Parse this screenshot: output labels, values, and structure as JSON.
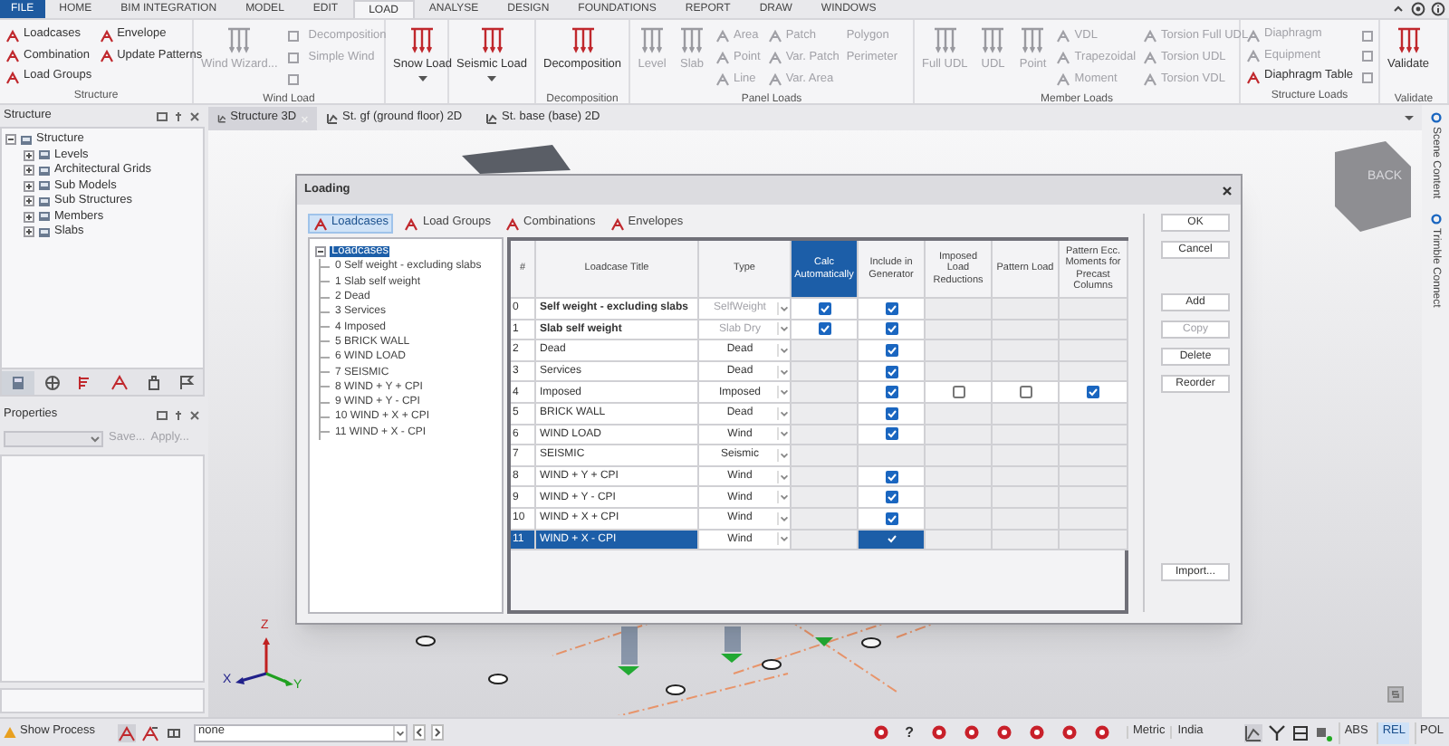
{
  "menu_tabs": [
    {
      "label": "FILE",
      "kind": "file",
      "selected": false
    },
    {
      "label": "HOME",
      "kind": "tab",
      "selected": false
    },
    {
      "label": "BIM INTEGRATION",
      "kind": "tab",
      "selected": false
    },
    {
      "label": "MODEL",
      "kind": "tab",
      "selected": false
    },
    {
      "label": "EDIT",
      "kind": "tab",
      "selected": false
    },
    {
      "label": "LOAD",
      "kind": "tab",
      "selected": true
    },
    {
      "label": "ANALYSE",
      "kind": "tab",
      "selected": false
    },
    {
      "label": "DESIGN",
      "kind": "tab",
      "selected": false
    },
    {
      "label": "FOUNDATIONS",
      "kind": "tab",
      "selected": false
    },
    {
      "label": "REPORT",
      "kind": "tab",
      "selected": false
    },
    {
      "label": "DRAW",
      "kind": "tab",
      "selected": false
    },
    {
      "label": "WINDOWS",
      "kind": "tab",
      "selected": false
    }
  ],
  "ribbon_groups": [
    {
      "label": "Structure",
      "items": [
        {
          "kind": "small",
          "label": "Loadcases",
          "disabled": false
        },
        {
          "kind": "small",
          "label": "Combination",
          "disabled": false
        },
        {
          "kind": "small",
          "label": "Load Groups",
          "disabled": false
        },
        {
          "kind": "small",
          "label": "Envelope",
          "disabled": false
        },
        {
          "kind": "small",
          "label": "Update Patterns",
          "disabled": false
        }
      ]
    },
    {
      "label": "Wind Load",
      "items": [
        {
          "kind": "large",
          "label": "Wind Wizard...",
          "disabled": true
        },
        {
          "kind": "icon",
          "disabled": true
        },
        {
          "kind": "icon",
          "disabled": true
        },
        {
          "kind": "icon",
          "disabled": true
        },
        {
          "kind": "text",
          "label": "Decomposition",
          "disabled": true
        },
        {
          "kind": "text",
          "label": "Simple Wind",
          "disabled": true
        }
      ]
    },
    {
      "items": [
        {
          "kind": "large",
          "label": "Snow Load",
          "dropdown": true,
          "disabled": false
        }
      ]
    },
    {
      "items": [
        {
          "kind": "large",
          "label": "Seismic Load",
          "dropdown": true,
          "disabled": false
        }
      ]
    },
    {
      "label": "Decomposition",
      "items": [
        {
          "kind": "large",
          "label": "Decomposition",
          "disabled": false
        }
      ]
    },
    {
      "label": "Panel Loads",
      "items": [
        {
          "kind": "large",
          "label": "Level",
          "disabled": true
        },
        {
          "kind": "large",
          "label": "Slab",
          "disabled": true
        },
        {
          "kind": "small",
          "label": "Area",
          "disabled": true
        },
        {
          "kind": "small",
          "label": "Point",
          "disabled": true
        },
        {
          "kind": "small",
          "label": "Line",
          "disabled": true
        },
        {
          "kind": "small",
          "label": "Patch",
          "disabled": true
        },
        {
          "kind": "small",
          "label": "Var. Patch",
          "disabled": true
        },
        {
          "kind": "small",
          "label": "Var. Area",
          "disabled": true
        },
        {
          "kind": "text",
          "label": "Polygon",
          "disabled": true
        },
        {
          "kind": "text",
          "label": "Perimeter",
          "disabled": true
        }
      ]
    },
    {
      "label": "Member Loads",
      "items": [
        {
          "kind": "large",
          "label": "Full UDL",
          "disabled": true
        },
        {
          "kind": "large",
          "label": "UDL",
          "disabled": true
        },
        {
          "kind": "large",
          "label": "Point",
          "disabled": true
        },
        {
          "kind": "small",
          "label": "VDL",
          "disabled": true
        },
        {
          "kind": "small",
          "label": "Trapezoidal",
          "disabled": true
        },
        {
          "kind": "small",
          "label": "Moment",
          "disabled": true
        },
        {
          "kind": "small",
          "label": "Torsion Full UDL",
          "disabled": true
        },
        {
          "kind": "small",
          "label": "Torsion UDL",
          "disabled": true
        },
        {
          "kind": "small",
          "label": "Torsion VDL",
          "disabled": true
        }
      ]
    },
    {
      "label": "Structure Loads",
      "items": [
        {
          "kind": "small",
          "label": "Diaphragm",
          "disabled": true
        },
        {
          "kind": "small",
          "label": "Equipment",
          "disabled": true
        },
        {
          "kind": "small",
          "label": "Diaphragm Table",
          "disabled": false
        },
        {
          "kind": "icon",
          "disabled": true
        },
        {
          "kind": "icon",
          "disabled": true
        },
        {
          "kind": "icon",
          "disabled": true
        }
      ]
    },
    {
      "label": "Validate",
      "items": [
        {
          "kind": "large",
          "label": "Validate",
          "disabled": false
        }
      ]
    }
  ],
  "structure_panel": {
    "title": "Structure",
    "tree": [
      {
        "label": "Structure",
        "expanded": true,
        "children": [
          {
            "label": "Levels",
            "expanded": false
          },
          {
            "label": "Architectural Grids",
            "expanded": false
          },
          {
            "label": "Sub Models",
            "expanded": false
          },
          {
            "label": "Sub Structures",
            "expanded": false
          },
          {
            "label": "Members",
            "expanded": false
          },
          {
            "label": "Slabs",
            "expanded": false
          }
        ]
      }
    ],
    "tool_tabs": [
      {
        "selected": true
      },
      {
        "selected": false
      },
      {
        "selected": false
      },
      {
        "selected": false
      },
      {
        "selected": false
      },
      {
        "selected": false
      }
    ]
  },
  "properties_panel": {
    "title": "Properties",
    "buttons": [
      {
        "label": "Save...",
        "disabled": true
      },
      {
        "label": "Apply...",
        "disabled": true
      }
    ]
  },
  "document_tabs": [
    {
      "label": "Structure 3D",
      "selected": true
    },
    {
      "label": "St. gf (ground floor) 2D",
      "selected": false
    },
    {
      "label": "St. base (base) 2D",
      "selected": false
    }
  ],
  "viewport": {
    "axis_labels": [
      "Z",
      "X",
      "Y"
    ],
    "view_cube_label": "BACK"
  },
  "side_tabs": [
    "Scene Content",
    "Trimble Connect"
  ],
  "dialog": {
    "title": "Loading",
    "tabs": [
      {
        "label": "Loadcases",
        "selected": true
      },
      {
        "label": "Load Groups",
        "selected": false
      },
      {
        "label": "Combinations",
        "selected": false
      },
      {
        "label": "Envelopes",
        "selected": false
      }
    ],
    "tree": {
      "label": "Loadcases",
      "selected": true,
      "expanded": true,
      "children": [
        {
          "label": "0 Self weight - excluding slabs",
          "selected": false
        },
        {
          "label": "1 Slab self weight",
          "selected": false
        },
        {
          "label": "2 Dead",
          "selected": false
        },
        {
          "label": "3 Services",
          "selected": false
        },
        {
          "label": "4 Imposed",
          "selected": false
        },
        {
          "label": "5 BRICK WALL",
          "selected": false
        },
        {
          "label": "6 WIND LOAD",
          "selected": false
        },
        {
          "label": "7 SEISMIC",
          "selected": false
        },
        {
          "label": "8 WIND + Y + CPI",
          "selected": false
        },
        {
          "label": "9 WIND + Y - CPI",
          "selected": false
        },
        {
          "label": "10 WIND + X + CPI",
          "selected": false
        },
        {
          "label": "11 WIND + X - CPI",
          "selected": false
        }
      ]
    },
    "table": {
      "columns": [
        {
          "label": "#",
          "selected": false
        },
        {
          "label": "Loadcase Title",
          "selected": false
        },
        {
          "label": "Type",
          "selected": false
        },
        {
          "label": "Calc Automatically",
          "selected": true
        },
        {
          "label": "Include in Generator",
          "selected": false
        },
        {
          "label": "Imposed Load Reductions",
          "selected": false
        },
        {
          "label": "Pattern Load",
          "selected": false
        },
        {
          "label": "Pattern Ecc. Moments for Precast Columns",
          "selected": false
        }
      ],
      "rows": [
        {
          "number": "0",
          "title": "Self weight - excluding slabs",
          "emphasized": true,
          "type": "SelfWeight",
          "type_disabled": true,
          "calc": true,
          "include": true,
          "selected": false
        },
        {
          "number": "1",
          "title": "Slab self weight",
          "emphasized": true,
          "type": "Slab Dry",
          "type_disabled": true,
          "calc": true,
          "include": true,
          "selected": false
        },
        {
          "number": "2",
          "title": "Dead",
          "emphasized": false,
          "type": "Dead",
          "type_disabled": false,
          "include": true,
          "selected": false
        },
        {
          "number": "3",
          "title": "Services",
          "emphasized": false,
          "type": "Dead",
          "type_disabled": false,
          "include": true,
          "selected": false
        },
        {
          "number": "4",
          "title": "Imposed",
          "emphasized": false,
          "type": "Imposed",
          "type_disabled": false,
          "include": true,
          "imposed_reductions": false,
          "pattern_load": false,
          "pattern_ecc": true,
          "selected": false
        },
        {
          "number": "5",
          "title": "BRICK WALL",
          "emphasized": false,
          "type": "Dead",
          "type_disabled": false,
          "include": true,
          "selected": false
        },
        {
          "number": "6",
          "title": "WIND LOAD",
          "emphasized": false,
          "type": "Wind",
          "type_disabled": false,
          "include": true,
          "selected": false
        },
        {
          "number": "7",
          "title": "SEISMIC",
          "emphasized": false,
          "type": "Seismic",
          "type_disabled": false,
          "selected": false
        },
        {
          "number": "8",
          "title": "WIND + Y + CPI",
          "emphasized": false,
          "type": "Wind",
          "type_disabled": false,
          "include": true,
          "selected": false
        },
        {
          "number": "9",
          "title": "WIND + Y - CPI",
          "emphasized": false,
          "type": "Wind",
          "type_disabled": false,
          "include": true,
          "selected": false
        },
        {
          "number": "10",
          "title": "WIND + X + CPI",
          "emphasized": false,
          "type": "Wind",
          "type_disabled": false,
          "include": true,
          "selected": false
        },
        {
          "number": "11",
          "title": "WIND + X - CPI",
          "emphasized": false,
          "type": "Wind",
          "type_disabled": false,
          "include": true,
          "selected": true
        }
      ]
    },
    "buttons_top": [
      {
        "label": "OK",
        "disabled": false
      },
      {
        "label": "Cancel",
        "disabled": false
      }
    ],
    "buttons_edit": [
      {
        "label": "Add",
        "disabled": false
      },
      {
        "label": "Copy",
        "disabled": true
      },
      {
        "label": "Delete",
        "disabled": false
      },
      {
        "label": "Reorder",
        "disabled": false
      }
    ],
    "buttons_bottom": [
      {
        "label": "Import...",
        "disabled": false
      }
    ]
  },
  "status_bar": {
    "show_process": "Show Process",
    "combo_value": "none",
    "help": "?",
    "units": "Metric",
    "region": "India",
    "toggles": [
      {
        "label": "ABS",
        "selected": false
      },
      {
        "label": "REL",
        "selected": true
      },
      {
        "label": "POL",
        "selected": false
      }
    ]
  }
}
